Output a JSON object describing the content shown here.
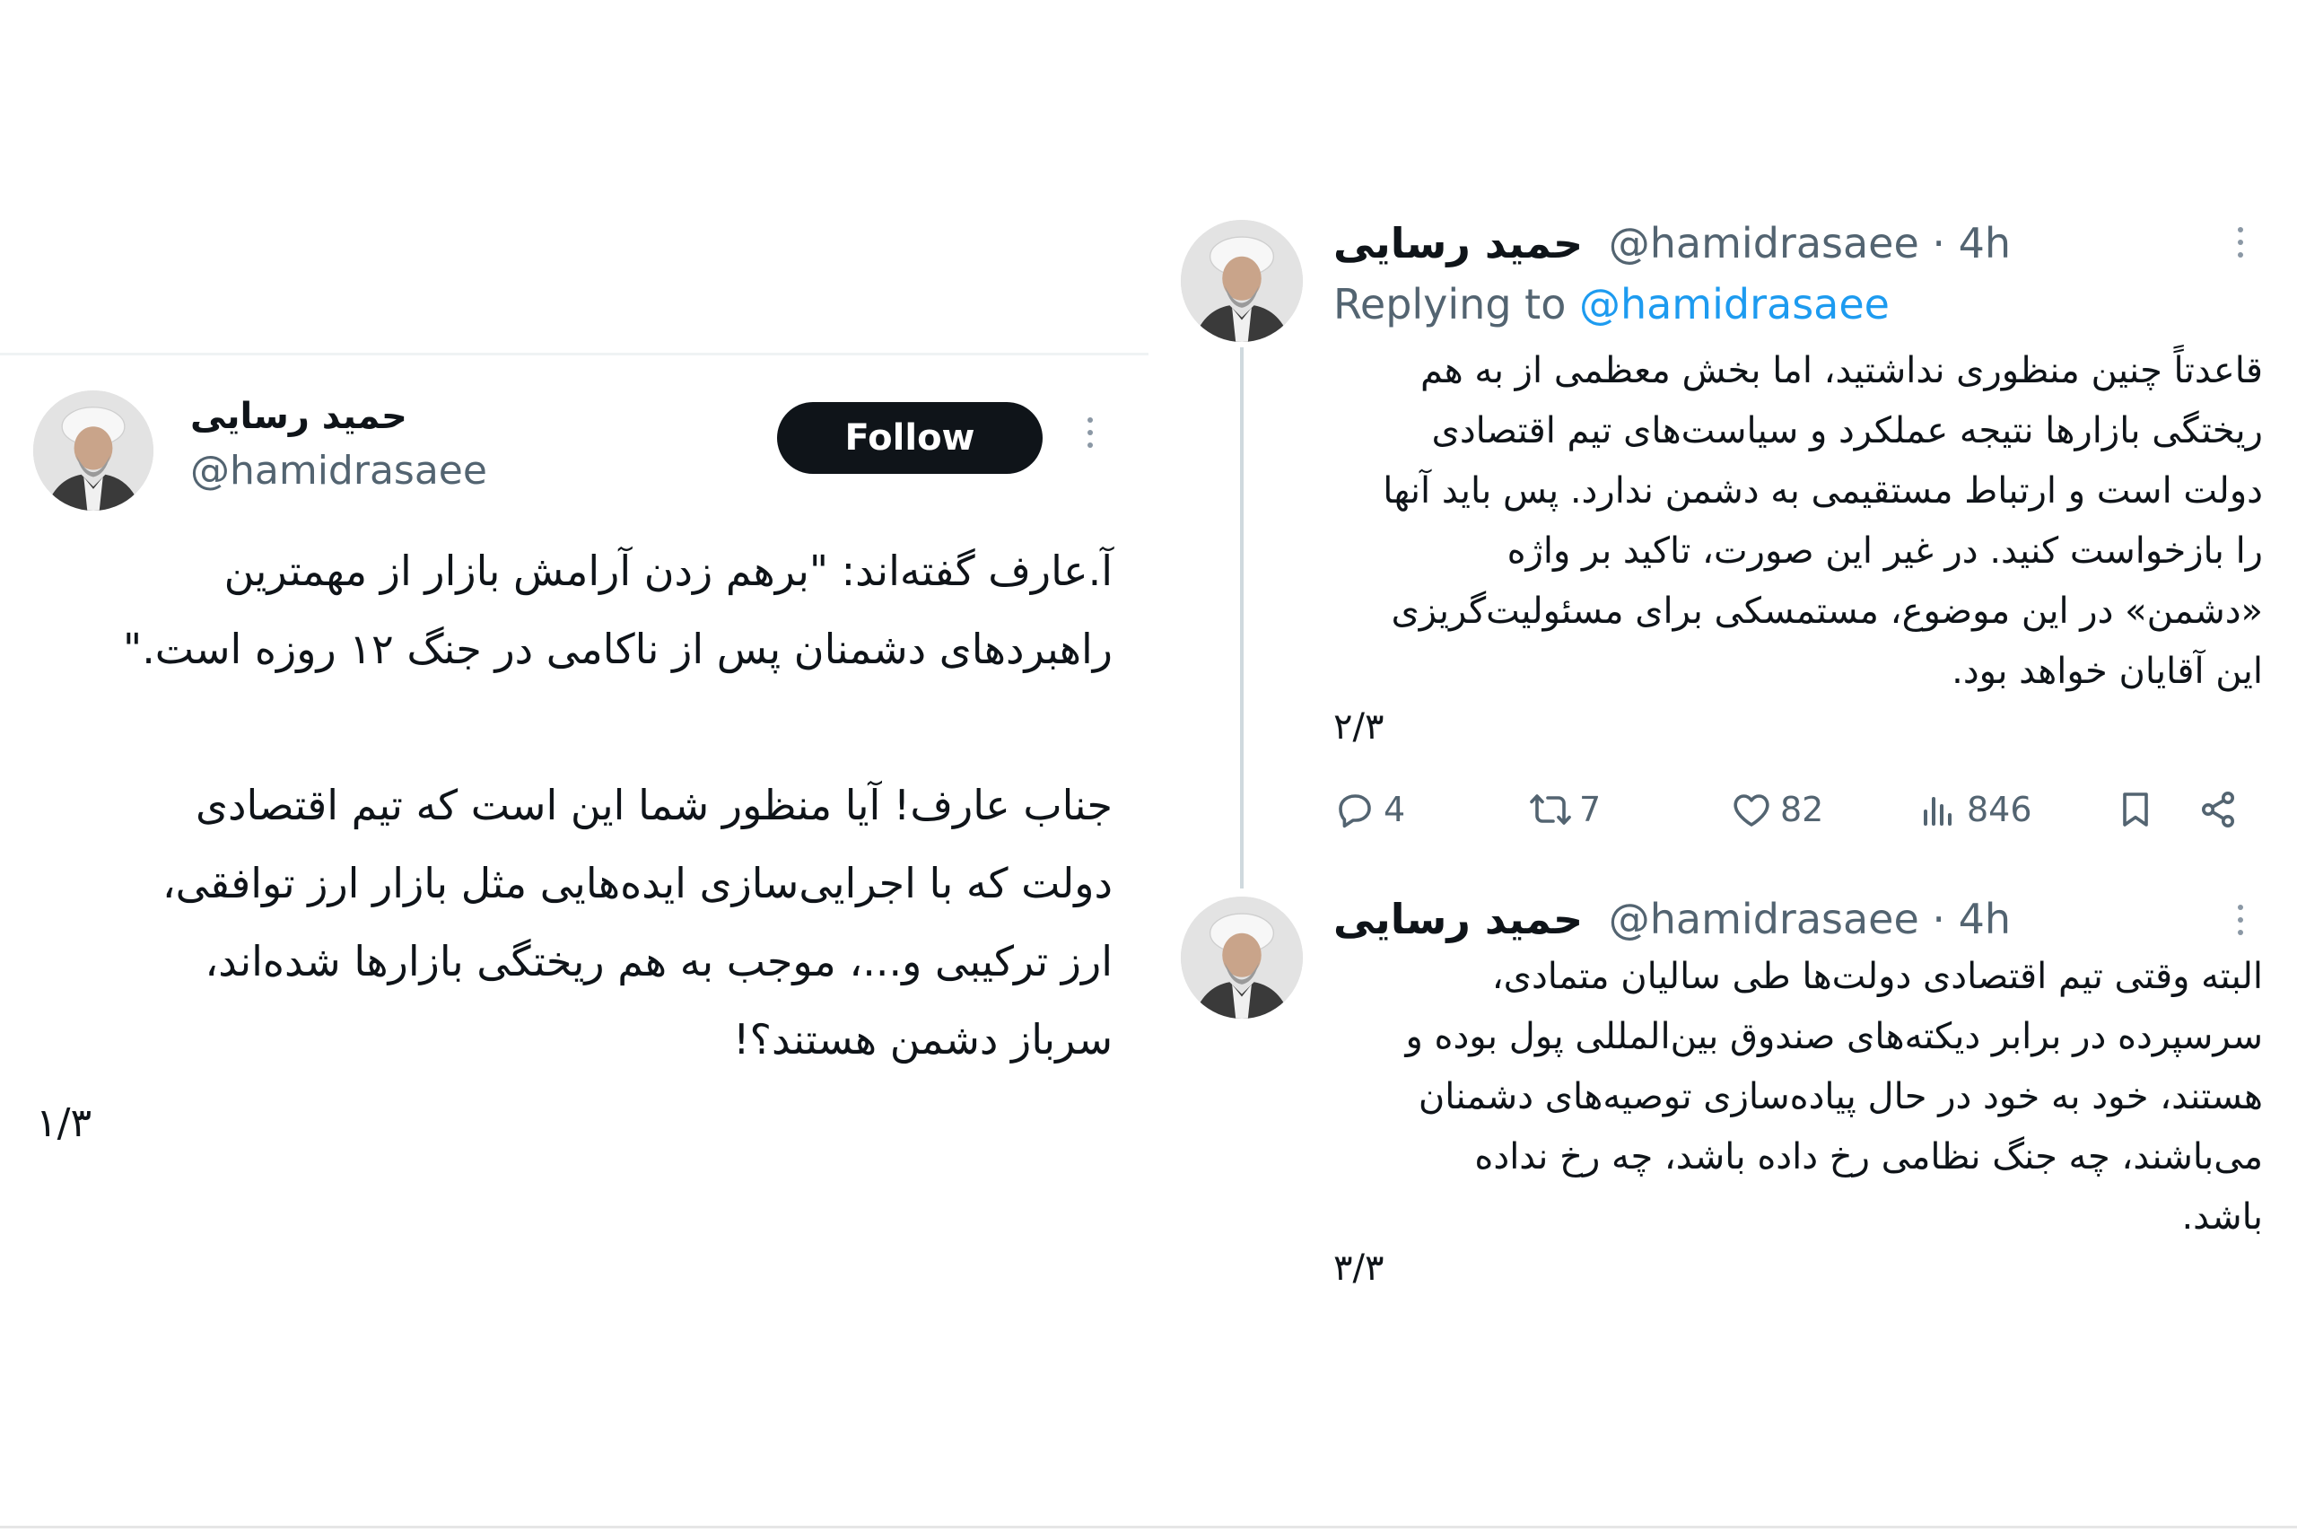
{
  "colors": {
    "text": "#0f1419",
    "secondary": "#536471",
    "link": "#1d9bf0",
    "follow_bg": "#0f1419"
  },
  "left_tweet": {
    "author_name": "حمید رسایی",
    "handle": "@hamidrasaee",
    "follow_label": "Follow",
    "body": "آ.عارف گفته‌اند: \"برهم زدن آرامش بازار از مهمترین\nراهبردهای دشمنان پس از ناکامی در جنگ ۱۲ روزه است.\"\n\nجناب عارف! آیا منظور شما این است که تیم اقتصادی\nدولت که با اجرایی‌سازی ایده‌هایی مثل بازار ارز توافقی،\nارز ترکیبی و...، موجب به هم ریختگی بازارها شده‌اند،\nسرباز دشمن هستند؟!",
    "counter": "۱/۳"
  },
  "right_tweets": [
    {
      "author_name": "حمید رسایی",
      "handle": "@hamidrasaee · 4h",
      "replying_prefix": "Replying to",
      "replying_handle": "@hamidrasaee",
      "body": "قاعدتاً چنین منظوری نداشتید، اما بخش معظمی از به هم\nریختگی بازارها نتیجه عملکرد و سیاست‌های تیم اقتصادی\nدولت است و ارتباط مستقیمی به دشمن ندارد. پس باید آنها\nرا بازخواست کنید. در غیر این صورت، تاکید بر واژه\n«دشمن» در این موضوع، مستمسکی برای مسئولیت‌گریزی\nاین آقایان خواهد بود.",
      "counter": "۲/۳",
      "replies": "4",
      "retweets": "7",
      "likes": "82",
      "views": "846"
    },
    {
      "author_name": "حمید رسایی",
      "handle": "@hamidrasaee · 4h",
      "body": "البته وقتی تیم اقتصادی دولت‌ها طی سالیان متمادی،\nسرسپرده در برابر دیکته‌های صندوق بین‌المللی پول بوده و\nهستند، خود به خود در حال پیاده‌سازی توصیه‌های دشمنان\nمی‌باشند، چه جنگ نظامی رخ داده باشد، چه رخ نداده\nباشد.",
      "counter": "۳/۳"
    }
  ]
}
